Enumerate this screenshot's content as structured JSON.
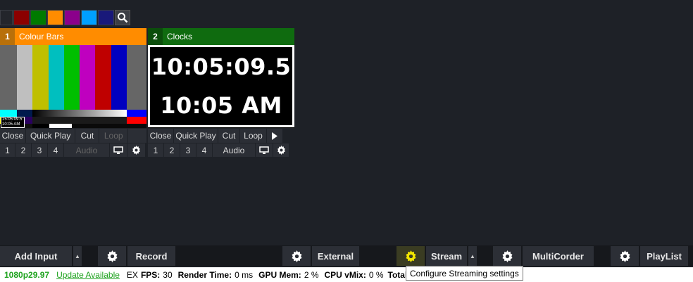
{
  "colors": {
    "swatches": [
      "#23252b",
      "#8b0000",
      "#007a00",
      "#ff8c00",
      "#8b008b",
      "#00a0ff",
      "#19197a"
    ],
    "input1_accent": "#ff8c00",
    "input1_num_bg": "#b8700a",
    "input2_accent": "#0f6b0f",
    "input2_num_bg": "#0b4d0b"
  },
  "inputs": [
    {
      "number": "1",
      "title": "Colour Bars",
      "buttons": [
        "Close",
        "Quick Play",
        "Cut",
        "Loop"
      ],
      "buses": [
        "1",
        "2",
        "3",
        "4"
      ],
      "audio": "Audio",
      "thumb_clock_lines": [
        "15:05:09.5",
        "10:05 AM"
      ]
    },
    {
      "number": "2",
      "title": "Clocks",
      "clock_time": "10:05:09.5",
      "clock_ampm": "10:05 AM",
      "buttons": [
        "Close",
        "Quick Play",
        "Cut",
        "Loop"
      ],
      "buses": [
        "1",
        "2",
        "3",
        "4"
      ],
      "audio": "Audio"
    }
  ],
  "toolbar": {
    "add_input": "Add Input",
    "record": "Record",
    "external": "External",
    "stream": "Stream",
    "multicorder": "MultiCorder",
    "playlist": "PlayList"
  },
  "status": {
    "resolution": "1080p29.97",
    "update": "Update Available",
    "ex": "EX",
    "fps_label": "FPS:",
    "fps": "30",
    "render_label": "Render Time:",
    "render": "0 ms",
    "gpu_label": "GPU Mem:",
    "gpu": "2 %",
    "cpu_label": "CPU vMix:",
    "cpu": "0 %",
    "total_label": "Total"
  },
  "tooltip": "Configure Streaming settings"
}
